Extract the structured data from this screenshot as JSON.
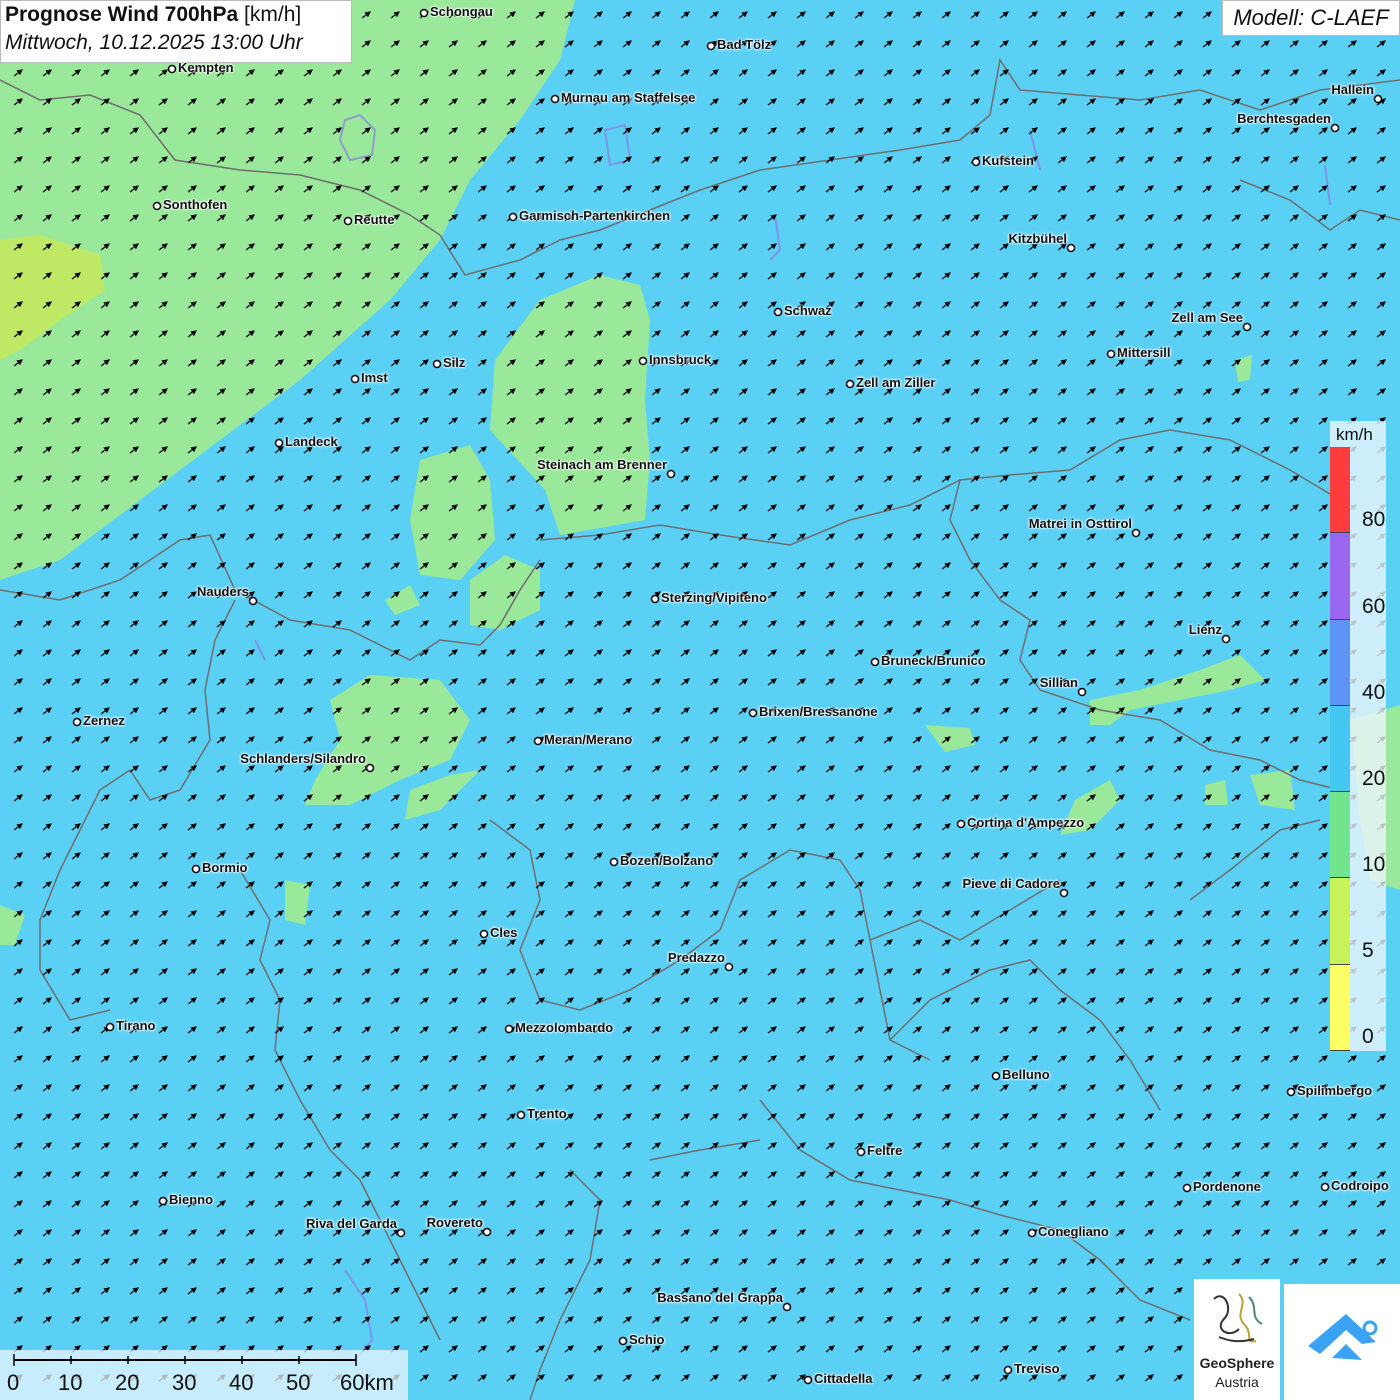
{
  "header": {
    "title_bold": "Prognose Wind 700hPa",
    "title_unit": "[km/h]",
    "datetime": "Mittwoch, 10.12.2025 13:00 Uhr",
    "model": "Modell: C-LAEF"
  },
  "legend": {
    "unit": "km/h",
    "labels": [
      "80",
      "60",
      "40",
      "20",
      "10",
      "5",
      "0"
    ],
    "colors": [
      "#ff3b3b",
      "#9a68f0",
      "#5e93f5",
      "#44c8f2",
      "#72e48c",
      "#c6f25a",
      "#ffff66"
    ]
  },
  "scale_bar": {
    "labels": [
      "0",
      "10",
      "20",
      "30",
      "40",
      "50",
      "60km"
    ]
  },
  "cities": [
    "Schongau",
    "Bad Tölz",
    "Kempten",
    "Murnau am Staffelsee",
    "Hallein",
    "Berchtesgaden",
    "Kufstein",
    "Sonthofen",
    "Reutte",
    "Garmisch-Partenkirchen",
    "Kitzbühel",
    "Schwaz",
    "Zell am See",
    "Innsbruck",
    "Mittersill",
    "Silz",
    "Imst",
    "Zell am Ziller",
    "Landeck",
    "Steinach am Brenner",
    "Matrei in Osttirol",
    "Nauders",
    "Sterzing/Vipiteno",
    "Lienz",
    "Bruneck/Brunico",
    "Sillian",
    "Zernez",
    "Brixen/Bressanone",
    "Meran/Merano",
    "Schlanders/Silandro",
    "Cortina d'Ampezzo",
    "Bormio",
    "Bozen/Bolzano",
    "Pieve di Cadore",
    "Cles",
    "Predazzo",
    "Tirano",
    "Mezzolombardo",
    "Belluno",
    "Spilimbergo",
    "Trento",
    "Feltre",
    "Pordenone",
    "Codroipo",
    "Bienno",
    "Riva del Garda",
    "Rovereto",
    "Conegliano",
    "Bassano del Grappa",
    "Schio",
    "Treviso",
    "Cittadella"
  ],
  "logos": {
    "geosphere_name": "GeoSphere",
    "geosphere_sub": "Austria"
  },
  "colors": {
    "wind_20_40": "#5bd0f5",
    "wind_10_20": "#9ae89a",
    "wind_5_10": "#c6e85a",
    "borders": "#6e6e6e",
    "arrows": "#000000"
  }
}
